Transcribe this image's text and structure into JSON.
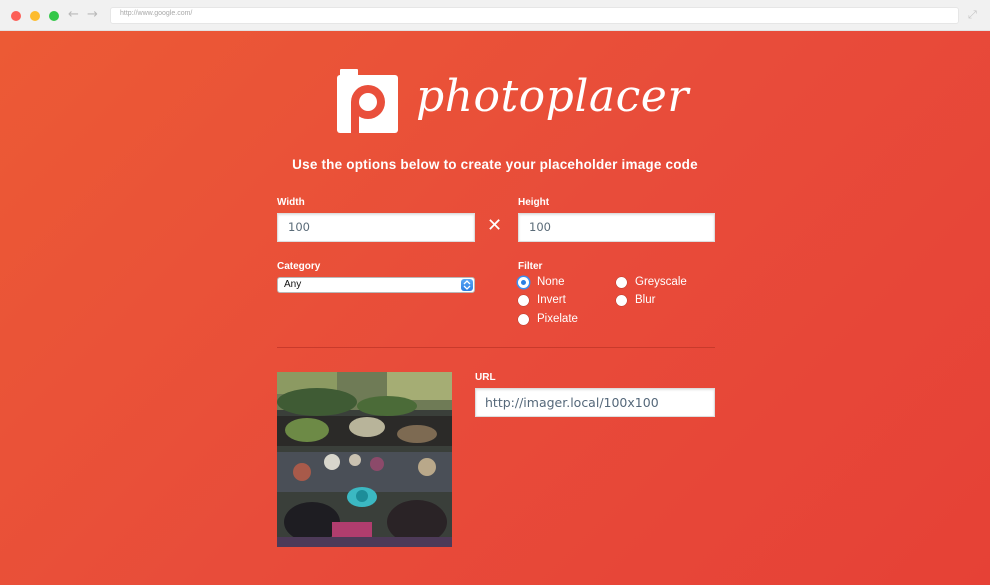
{
  "browser": {
    "address_url": "http://www.google.com/",
    "icons": [
      "back-arrow-icon",
      "forward-arrow-icon",
      "expand-icon"
    ]
  },
  "app": {
    "logo_text": "photoplacer",
    "intro": "Use the options below to create your placeholder image code"
  },
  "form": {
    "width_label": "Width",
    "width_value": "100",
    "height_label": "Height",
    "height_value": "100",
    "times_symbol": "✕",
    "category_label": "Category",
    "category_value": "Any",
    "filter_label": "Filter",
    "filters": [
      {
        "label": "None",
        "checked": true
      },
      {
        "label": "Greyscale",
        "checked": false
      },
      {
        "label": "Invert",
        "checked": false
      },
      {
        "label": "Blur",
        "checked": false
      },
      {
        "label": "Pixelate",
        "checked": false
      }
    ],
    "url_label": "URL",
    "url_value": "http://imager.local/100x100"
  },
  "colors": {
    "accent": "#e84c3a",
    "radio_checked": "#2a7fe3"
  }
}
